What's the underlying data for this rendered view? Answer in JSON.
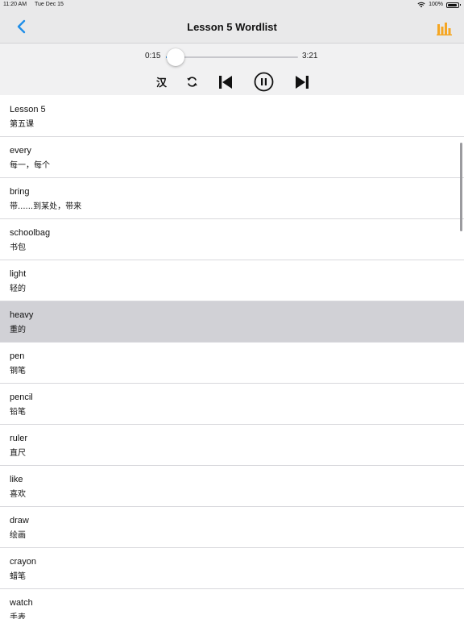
{
  "status_bar": {
    "time": "11:20 AM",
    "date": "Tue Dec 15",
    "battery": "100%"
  },
  "nav": {
    "title": "Lesson 5 Wordlist",
    "back_icon": "chevron-left-icon",
    "right_icon": "bar-chart-icon"
  },
  "player": {
    "current_time": "0:15",
    "total_time": "3:21",
    "progress": 0.075,
    "hanzi_toggle_label": "汉",
    "buttons": [
      "repeat-icon",
      "skip-previous-icon",
      "pause-icon",
      "skip-next-icon"
    ]
  },
  "words": [
    {
      "en": "Lesson 5",
      "zh": "第五课"
    },
    {
      "en": "every",
      "zh": "每一，每个"
    },
    {
      "en": "bring",
      "zh": "带......到某处，带来"
    },
    {
      "en": "schoolbag",
      "zh": "书包"
    },
    {
      "en": "light",
      "zh": "轻的"
    },
    {
      "en": "heavy",
      "zh": "重的"
    },
    {
      "en": "pen",
      "zh": "钢笔"
    },
    {
      "en": "pencil",
      "zh": "铅笔"
    },
    {
      "en": "ruler",
      "zh": "直尺"
    },
    {
      "en": "like",
      "zh": "喜欢"
    },
    {
      "en": "draw",
      "zh": "绘画"
    },
    {
      "en": "crayon",
      "zh": "蜡笔"
    },
    {
      "en": "watch",
      "zh": "手表"
    }
  ],
  "selected_index": 5,
  "colors": {
    "accent": "#1f8ee8",
    "chart_icon": "#f5a623",
    "header_bg": "#e9e9ea",
    "selected_row": "#d1d1d6"
  }
}
